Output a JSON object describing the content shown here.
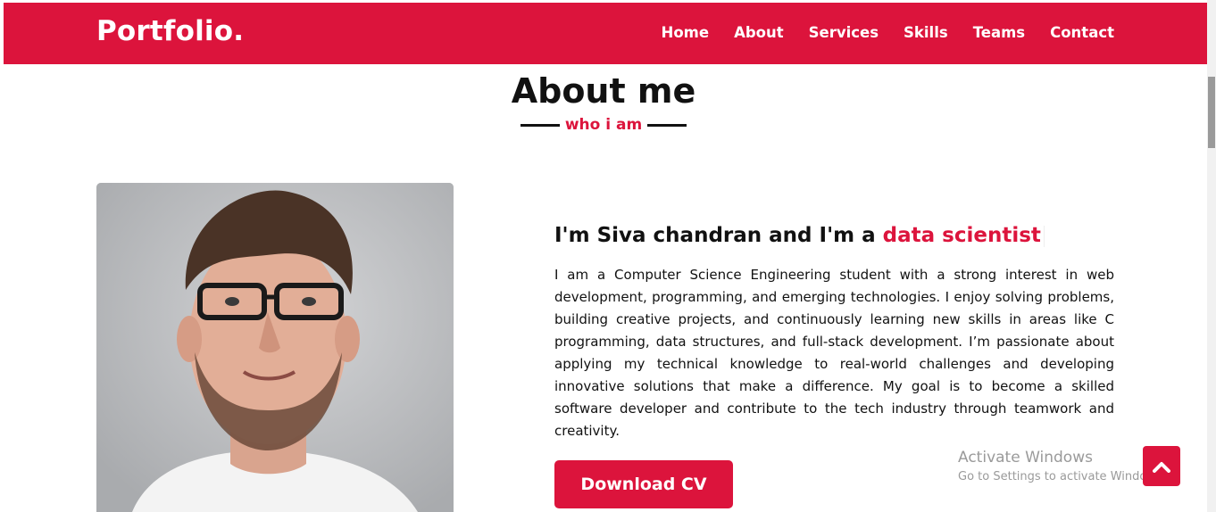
{
  "brand": {
    "logo": "Portfolio."
  },
  "nav": {
    "items": [
      {
        "label": "Home"
      },
      {
        "label": "About"
      },
      {
        "label": "Services"
      },
      {
        "label": "Skills"
      },
      {
        "label": "Teams"
      },
      {
        "label": "Contact"
      }
    ]
  },
  "about": {
    "title": "About me",
    "subtitle": "who i am",
    "heading_prefix": "I'm Siva chandran and I'm a",
    "heading_role": "data scientist",
    "paragraph": "I am a Computer Science Engineering student with a strong interest in web development, programming, and emerging technologies. I enjoy solving problems, building creative projects, and continuously learning new skills in areas like C programming, data structures, and full-stack development. I’m passionate about applying my technical knowledge to real-world challenges and developing innovative solutions that make a difference. My goal is to become a skilled software developer and contribute to the tech industry through teamwork and creativity.",
    "cv_button": "Download CV"
  },
  "watermark": {
    "line1": "Activate Windows",
    "line2": "Go to Settings to activate Windows."
  },
  "icons": {
    "scroll_top": "chevron-up-icon",
    "photo": "profile-photo"
  },
  "colors": {
    "accent": "#dc143c",
    "text": "#111111",
    "background": "#ffffff"
  }
}
